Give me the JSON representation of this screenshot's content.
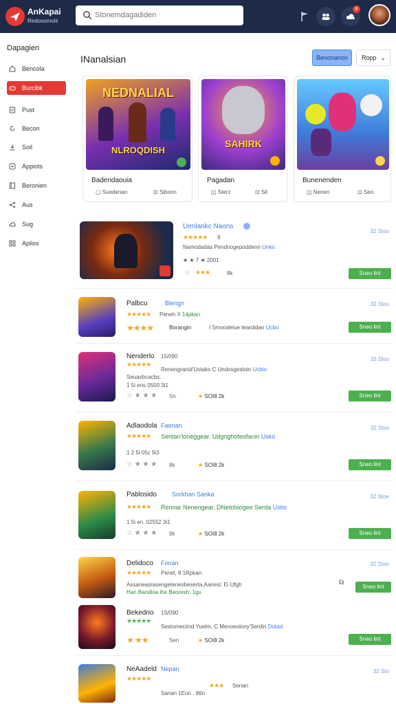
{
  "header": {
    "brand": "AnKapai",
    "brand_sub": "Redosomolii",
    "search_placeholder": "Stonemdagadiden",
    "notif_count": "8"
  },
  "sidebar": {
    "title": "Dapagien",
    "items": [
      {
        "label": "Bencola",
        "icon": "home-icon"
      },
      {
        "label": "Burcibk",
        "icon": "gamepad-icon",
        "active": true
      },
      {
        "label": "Pust",
        "icon": "document-icon"
      },
      {
        "label": "Becon",
        "icon": "refresh-icon"
      },
      {
        "label": "Soil",
        "icon": "download-icon"
      },
      {
        "label": "Appiots",
        "icon": "apps-icon"
      },
      {
        "label": "Beronien",
        "icon": "book-icon"
      },
      {
        "label": "Aus",
        "icon": "share-icon"
      },
      {
        "label": "Sug",
        "icon": "cloud-icon"
      },
      {
        "label": "Aplios",
        "icon": "grid-icon"
      }
    ]
  },
  "main": {
    "title": "INanalsian",
    "filter_button": "Benonanon",
    "sort_label": "Ropp"
  },
  "featured": [
    {
      "art_title": "NEDNALIAL",
      "art_sub": "NLROQDISH",
      "title": "Badendaouia",
      "meta1": "Suedenan",
      "meta2": "Sibonn",
      "colors": [
        "#f0a020",
        "#7a2fb0",
        "#1c2a6e"
      ]
    },
    {
      "art_title": "SAHIRK",
      "art_sub": "",
      "title": "Pagadan",
      "meta1": "Sterz",
      "meta2": "Sil",
      "colors": [
        "#ff9a40",
        "#9c3fd0",
        "#3a2a7a"
      ]
    },
    {
      "art_title": "",
      "art_sub": "",
      "title": "Bunenenden",
      "meta1": "Nenen",
      "meta2": "Seo",
      "colors": [
        "#66c8ff",
        "#3f7bd9",
        "#6b3fa0"
      ]
    }
  ],
  "list": [
    {
      "title": "Uenlankc Naons",
      "sub": "",
      "rating": "9",
      "desc": "Namodadas Pendnogepoddenn",
      "desc_link": "Unko",
      "small1": "★ ★ 7 ★ 2001",
      "count": "8k",
      "meta": "32 Stoo",
      "btn": "Sneo lint"
    },
    {
      "title": "Palbcu",
      "sub": "Blengn",
      "rating": "",
      "desc": "Peneh",
      "desc_link": "X 14pkan",
      "small1": "Borangin",
      "desc2": "I Smoodelue teardidan",
      "desc2_link": "Ucbo",
      "count": "",
      "meta": "32 Stos",
      "btn": "Sneo lint"
    },
    {
      "title": "Nenderlo",
      "sub": "15/090",
      "rating": "",
      "desc": "Renengranid'Uotaks C Undosgestoin",
      "desc_link": "Ucbio",
      "small1": "Seuavbcacbs.",
      "small2": "1 5i ens 0500 3i1",
      "count": "Sn",
      "gold": "SOI8 2k",
      "meta": "33 Stos",
      "btn": "Sneo lint"
    },
    {
      "title": "Adlaodola",
      "sub": "Faenan",
      "rating": "",
      "desc": "Sentan'loneggear. Udgnghoteofanin",
      "desc_link": "Usko",
      "small1": "1 2 5i 05c 9i3",
      "count": "8k",
      "gold": "SOI8 2k",
      "meta": "32 Stos",
      "btn": "Sneo lint"
    },
    {
      "title": "Pablosido",
      "sub": "Sorkhan Sanka",
      "rating": "",
      "desc": "Rennar Nenengear, DNetobiogee Serda",
      "desc_link": "Ustio",
      "small1": "1 5i en. 02552 3i1",
      "count": "8k",
      "gold": "SOI8 2k",
      "meta": "32 Stoe",
      "btn": "Sneo lint"
    },
    {
      "title": "Delidoco",
      "sub": "Fonan",
      "rating": "",
      "desc": "Penel, 8 1Rpkan",
      "small1": "Assaneasrasengetenesbeserta,Aanesl. Ei Ufgh",
      "small2": "Han Bandloa ihe Beoresh. 1gu",
      "count": "",
      "meta": "32 Stoo",
      "btn": "Sneo lint"
    },
    {
      "title": "Bekedrio",
      "sub": "1S/090",
      "rating": "",
      "desc": "Sestomecimd Yuelm, C Menoeolony'Serdin",
      "desc_link": "Dotad",
      "small1": "",
      "count": "Sen",
      "gold": "SOI8 2k",
      "meta": "",
      "btn": "Sneo lint"
    },
    {
      "title": "NeAadeld",
      "sub": "Nepan",
      "rating": "",
      "desc": "Serian",
      "small1": "Sanan 1Eon , 86n",
      "count": "",
      "meta": "32 Sto",
      "btn": ""
    }
  ]
}
